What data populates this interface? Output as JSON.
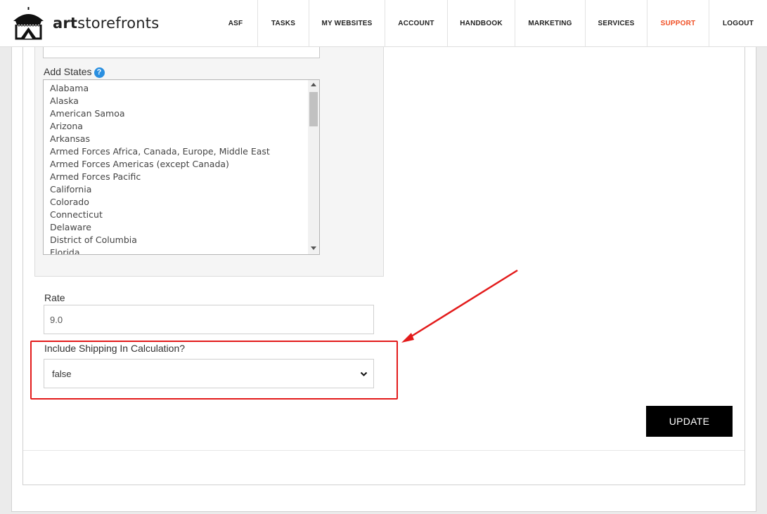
{
  "header": {
    "logo_text_bold": "art",
    "logo_text_rest": "storefronts",
    "nav": [
      {
        "label": "ASF",
        "active": false
      },
      {
        "label": "TASKS",
        "active": false
      },
      {
        "label": "MY WEBSITES",
        "active": false
      },
      {
        "label": "ACCOUNT",
        "active": false
      },
      {
        "label": "HANDBOOK",
        "active": false
      },
      {
        "label": "MARKETING",
        "active": false
      },
      {
        "label": "SERVICES",
        "active": false
      },
      {
        "label": "SUPPORT",
        "active": true
      },
      {
        "label": "LOGOUT",
        "active": false
      }
    ]
  },
  "form": {
    "add_states_label": "Add States",
    "help_icon": "?",
    "states": [
      "Alabama",
      "Alaska",
      "American Samoa",
      "Arizona",
      "Arkansas",
      "Armed Forces Africa, Canada, Europe, Middle East",
      "Armed Forces Americas (except Canada)",
      "Armed Forces Pacific",
      "California",
      "Colorado",
      "Connecticut",
      "Delaware",
      "District of Columbia",
      "Florida"
    ],
    "rate_label": "Rate",
    "rate_value": "9.0",
    "include_shipping_label": "Include Shipping In Calculation?",
    "include_shipping_value": "false",
    "update_button": "UPDATE"
  },
  "colors": {
    "accent": "#f04e23",
    "highlight": "#e31b1b",
    "help": "#2a8fe0"
  }
}
